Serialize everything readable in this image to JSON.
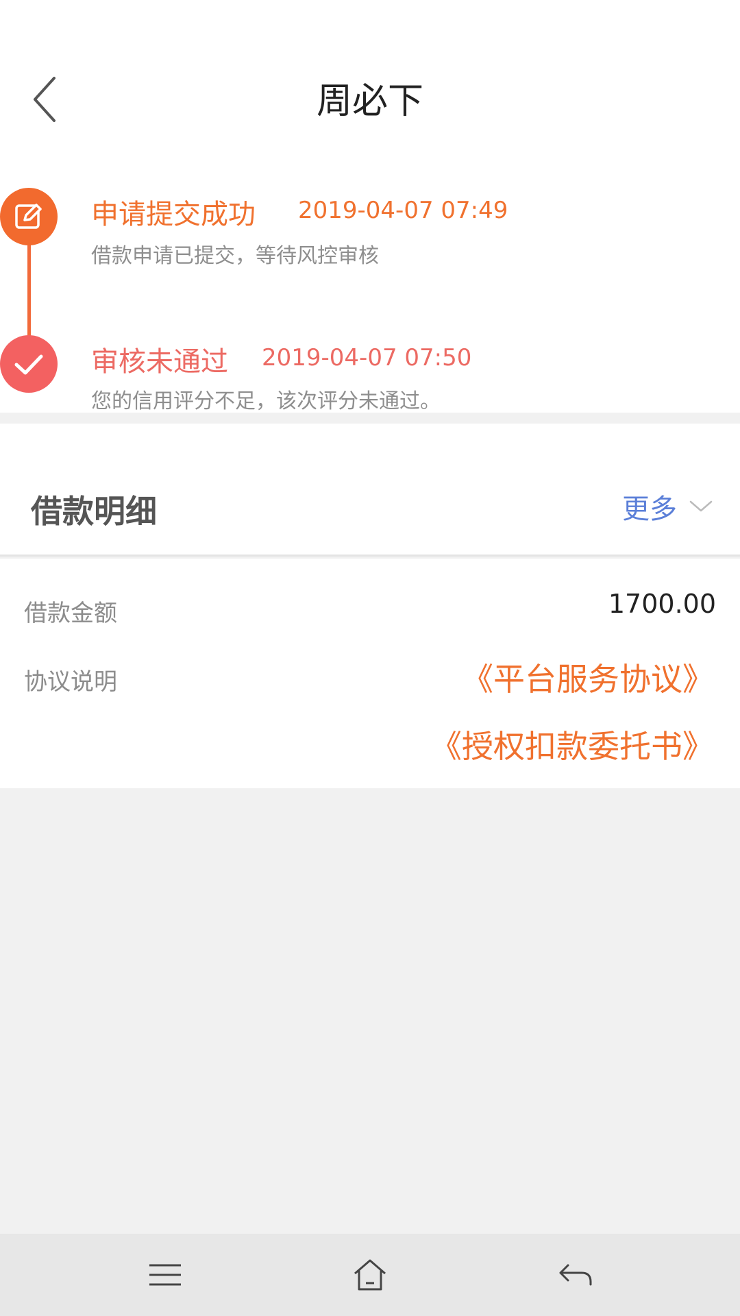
{
  "header": {
    "title": "周必下",
    "back_icon": "chevron-left-icon"
  },
  "timeline": {
    "steps": [
      {
        "title": "申请提交成功",
        "time": "2019-04-07 07:49",
        "desc": "借款申请已提交，等待风控审核",
        "icon": "edit-icon",
        "color": "#f26a2e"
      },
      {
        "title": "审核未通过",
        "time": "2019-04-07 07:50",
        "desc": "您的信用评分不足，该次评分未通过。",
        "icon": "check-icon",
        "color": "#f36161"
      }
    ]
  },
  "detail": {
    "title": "借款明细",
    "more_label": "更多",
    "amount_label": "借款金额",
    "amount_value": "1700.00",
    "agreement_label": "协议说明",
    "agreements": [
      "《平台服务协议》",
      "《授权扣款委托书》"
    ]
  },
  "colors": {
    "accent": "#f0712e",
    "error": "#ec6a63",
    "link": "#5b7fd8"
  }
}
